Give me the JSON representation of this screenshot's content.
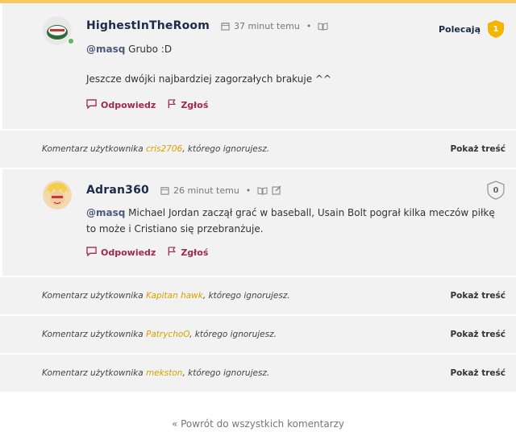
{
  "comments": [
    {
      "author": "HighestInTheRoom",
      "time": "37 minut temu",
      "mention": "@masq",
      "text_line1": "Grubo :D",
      "text_line2": "Jeszcze dwójki najbardziej zagorzałych brakuje ^^",
      "reply": "Odpowiedz",
      "report": "Zgłoś",
      "recommend_label": "Polecają",
      "recommend_count": "1"
    },
    {
      "author": "Adran360",
      "time": "26 minut temu",
      "mention": "@masq",
      "text": "Michael Jordan zaczął grać w baseball, Usain Bolt pograł kilka meczów piłkę to może i Cristiano się przebranżuje.",
      "reply": "Odpowiedz",
      "report": "Zgłoś",
      "recommend_count": "0"
    }
  ],
  "ignored": [
    {
      "prefix": "Komentarz użytkownika ",
      "user": "cris2706",
      "suffix": ", którego ignorujesz.",
      "show": "Pokaż treść"
    },
    {
      "prefix": "Komentarz użytkownika ",
      "user": "Kapitan hawk",
      "suffix": ", którego ignorujesz.",
      "show": "Pokaż treść"
    },
    {
      "prefix": "Komentarz użytkownika ",
      "user": "PatrychoO",
      "suffix": ", którego ignorujesz.",
      "show": "Pokaż treść"
    },
    {
      "prefix": "Komentarz użytkownika ",
      "user": "mekston",
      "suffix": ", którego ignorujesz.",
      "show": "Pokaż treść"
    }
  ],
  "back_link": "« Powrót do wszystkich komentarzy",
  "colors": {
    "accent": "#a0294a",
    "mention": "#4a5a7a",
    "ignored_user": "#d9a100",
    "badge": "#f4b400"
  },
  "icons": [
    "calendar-icon",
    "book-icon",
    "edit-icon",
    "reply-icon",
    "flag-icon",
    "shield-badge-icon",
    "online-status-icon"
  ]
}
